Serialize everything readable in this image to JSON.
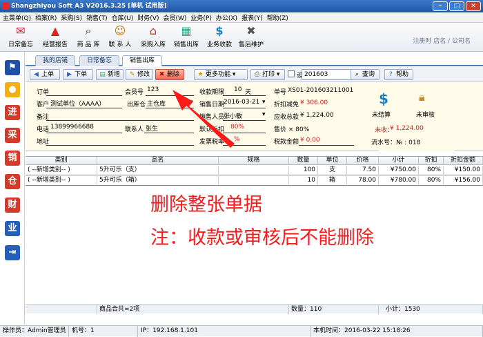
{
  "window": {
    "title": "Shangzhiyou Soft A3 V2016.3.25 [单机 试用版]"
  },
  "menu": [
    "主菜单(Q)",
    "档案(R)",
    "采购(S)",
    "销售(T)",
    "仓库(U)",
    "财务(V)",
    "会员(W)",
    "业务(P)",
    "办公(X)",
    "报表(Y)",
    "帮助(Z)"
  ],
  "toolbar": [
    {
      "label": "日常备忘",
      "icon": "envelope-icon"
    },
    {
      "label": "经营报告",
      "icon": "cap-icon"
    },
    {
      "label": "商 品 库",
      "icon": "magnifier-icon"
    },
    {
      "label": "联 系 人",
      "icon": "person-icon"
    },
    {
      "label": "采购入库",
      "icon": "house-icon"
    },
    {
      "label": "销售出库",
      "icon": "cert-icon"
    },
    {
      "label": "业务收款",
      "icon": "dollar-icon"
    },
    {
      "label": "售后维护",
      "icon": "tools-icon"
    }
  ],
  "registered": "注册时 店名 / 公司名",
  "leftbar": [
    {
      "icon": "flag-icon",
      "glyph": "⚑",
      "color": "#1f4fa6"
    },
    {
      "icon": "bulb-icon",
      "glyph": "●",
      "color": "#e8a316"
    },
    {
      "icon": "jin-icon",
      "glyph": "进",
      "color": "#d63a2c"
    },
    {
      "icon": "cai-icon",
      "glyph": "采",
      "color": "#d63a2c"
    },
    {
      "icon": "xiao-icon",
      "glyph": "销",
      "color": "#d63a2c"
    },
    {
      "icon": "cang-icon",
      "glyph": "仓",
      "color": "#d63a2c"
    },
    {
      "icon": "cai2-icon",
      "glyph": "财",
      "color": "#d63a2c"
    },
    {
      "icon": "ye-icon",
      "glyph": "业",
      "color": "#2460b8"
    },
    {
      "icon": "exit-icon",
      "glyph": "⇥",
      "color": "#2460b8"
    }
  ],
  "tabs": [
    "我的店铺",
    "日常备忘",
    "销售出库"
  ],
  "actions": {
    "prev": "上单",
    "next": "下单",
    "new": "新增",
    "edit": "修改",
    "delete": "删除",
    "more": "更多功能",
    "print": "打印",
    "design": "设计",
    "search_value": "201603",
    "query": "查询",
    "help": "帮助"
  },
  "form": {
    "order_label": "订单",
    "member_label": "会员号",
    "member_value": "123",
    "period_label": "收款期限",
    "period_value": "10",
    "period_unit": "天",
    "docno_label": "单号",
    "docno_value": "XS01-201603211001",
    "customer_label": "客户",
    "customer_value": "测试单位（AAAA）",
    "warehouse_label": "出库仓",
    "warehouse_value": "主仓库",
    "date_label": "销售日期",
    "date_value": "2016-03-21",
    "discount_label": "折扣减免",
    "discount_value": "¥ 306.00",
    "remark_label": "备注",
    "salesman_label": "销售人员",
    "salesman_value": "张小敏",
    "total_label": "应收总款",
    "total_value": "¥ 1,224.00",
    "phone_label": "电话",
    "phone_value": "13899966688",
    "contact_label": "联系人",
    "contact_value": "张生",
    "defaultdisc_label": "默认折扣",
    "defaultdisc_value": "80%",
    "price_label": "售价 × 80%",
    "address_label": "地址",
    "tax_label": "发票税率",
    "tax_value": "%",
    "taxamt_label": "税款金额",
    "taxamt_value": "¥ 0.00",
    "unsettled": "未结算",
    "unaudited": "未审核",
    "uncollected_label": "未收：",
    "uncollected_value": "¥ 1,224.00",
    "serial": "流水号：№ : 018"
  },
  "table": {
    "headers": [
      "类别",
      "品名",
      "规格",
      "数量",
      "单位",
      "价格",
      "小计",
      "折扣",
      "折扣金额"
    ],
    "rows": [
      [
        "( --新增类别-- )",
        "5升可乐（支）",
        "",
        "100",
        "支",
        "7.50",
        "¥750.00",
        "80%",
        "¥150.00"
      ],
      [
        "( --新增类别-- )",
        "5升可乐（箱）",
        "",
        "10",
        "箱",
        "78.00",
        "¥780.00",
        "80%",
        "¥156.00"
      ]
    ],
    "footer": {
      "count": "商品合共=2项",
      "qty": "数量：110",
      "subtotal": "小计：1530"
    }
  },
  "annotation": {
    "line1": "删除整张单据",
    "line2": "注：收款或审核后不能删除"
  },
  "status": {
    "operator": "操作员：Admin管理员",
    "machine": "机号：1",
    "ip": "IP：192.168.1.101",
    "time": "本机时间：2016-03-22 15:18:26"
  }
}
